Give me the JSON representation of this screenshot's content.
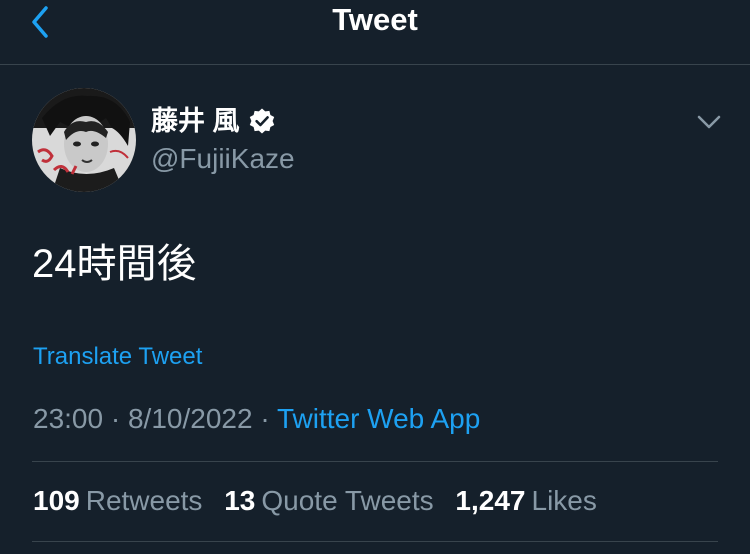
{
  "header": {
    "title": "Tweet",
    "back_icon": "chevron-left-icon"
  },
  "author": {
    "display_name": "藤井 風",
    "handle": "@FujiiKaze",
    "verified": true,
    "verified_icon": "verified-badge-icon"
  },
  "tweet": {
    "text": "24時間後",
    "translate_label": "Translate Tweet",
    "time": "23:00",
    "separator": "·",
    "date": "8/10/2022",
    "source": "Twitter Web App"
  },
  "stats": {
    "retweets_count": "109",
    "retweets_label": "Retweets",
    "quote_count": "13",
    "quote_label": "Quote Tweets",
    "likes_count": "1,247",
    "likes_label": "Likes"
  },
  "colors": {
    "background": "#15202b",
    "accent": "#1da1f2",
    "secondary_text": "#8899a6",
    "divider": "#38444d"
  }
}
